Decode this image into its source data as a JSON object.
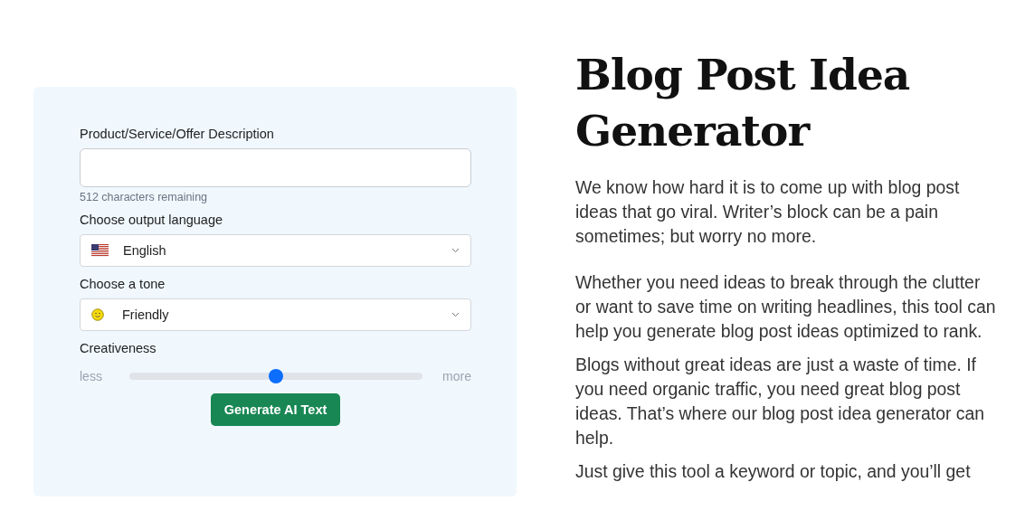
{
  "form": {
    "description": {
      "label": "Product/Service/Offer Description",
      "counter": "512 characters remaining"
    },
    "language": {
      "label": "Choose output language",
      "value": "English"
    },
    "tone": {
      "label": "Choose a tone",
      "value": "Friendly"
    },
    "creativeness": {
      "label": "Creativeness",
      "min_label": "less",
      "max_label": "more",
      "level": 0.5
    },
    "button": "Generate AI Text"
  },
  "article": {
    "title": "Blog Post Idea Generator",
    "paragraphs": [
      "We know how hard it is to come up with blog post ideas that go viral. Writer’s block can be a pain sometimes; but worry no more.",
      "Whether you need ideas to break through the clutter or want to save time on writing headlines, this tool can help you generate blog post ideas optimized to rank.",
      "Blogs without great ideas are just a waste of time. If you need organic traffic, you need great blog post ideas. That’s where our blog post idea generator can help.",
      "Just give this tool a keyword or topic, and you’ll get"
    ]
  }
}
